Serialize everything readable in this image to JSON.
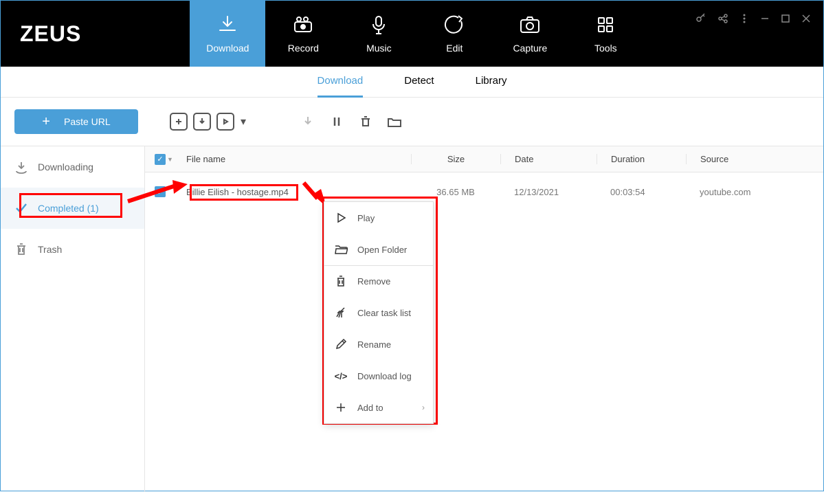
{
  "app": {
    "logo": "ZEUS"
  },
  "nav": {
    "download": "Download",
    "record": "Record",
    "music": "Music",
    "edit": "Edit",
    "capture": "Capture",
    "tools": "Tools"
  },
  "subtabs": {
    "download": "Download",
    "detect": "Detect",
    "library": "Library"
  },
  "toolbar": {
    "paste_url": "Paste URL"
  },
  "sidebar": {
    "downloading": "Downloading",
    "completed": "Completed (1)",
    "trash": "Trash"
  },
  "table": {
    "headers": {
      "filename": "File name",
      "size": "Size",
      "date": "Date",
      "duration": "Duration",
      "source": "Source"
    },
    "row": {
      "filename": "Billie Eilish - hostage.mp4",
      "size": "36.65 MB",
      "date": "12/13/2021",
      "duration": "00:03:54",
      "source": "youtube.com"
    }
  },
  "menu": {
    "play": "Play",
    "open_folder": "Open Folder",
    "remove": "Remove",
    "clear_task": "Clear task list",
    "rename": "Rename",
    "download_log": "Download log",
    "add_to": "Add to"
  }
}
